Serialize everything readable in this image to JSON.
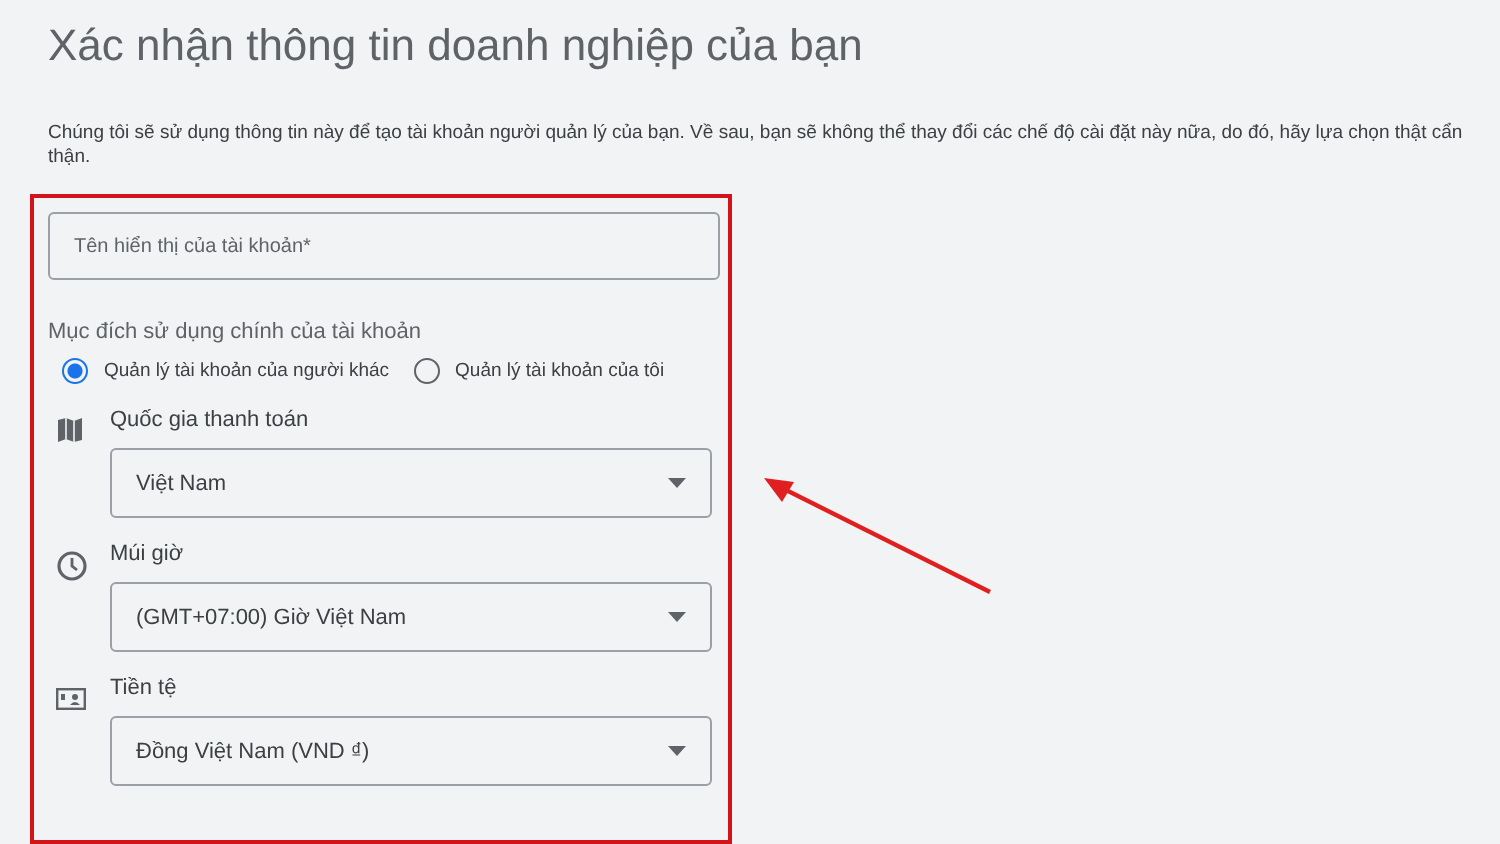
{
  "title": "Xác nhận thông tin doanh nghiệp của bạn",
  "description": "Chúng tôi sẽ sử dụng thông tin này để tạo tài khoản người quản lý của bạn. Về sau, bạn sẽ không thể thay đổi các chế độ cài đặt này nữa, do đó, hãy lựa chọn thật cẩn thận.",
  "name_field": {
    "placeholder": "Tên hiển thị của tài khoản*"
  },
  "purpose": {
    "label": "Mục đích sử dụng chính của tài khoản",
    "options": [
      {
        "label": "Quản lý tài khoản của người khác",
        "selected": true
      },
      {
        "label": "Quản lý tài khoản của tôi",
        "selected": false
      }
    ]
  },
  "sections": [
    {
      "kind": "map",
      "label": "Quốc gia thanh toán",
      "value": "Việt Nam"
    },
    {
      "kind": "clock",
      "label": "Múi giờ",
      "value": "(GMT+07:00) Giờ Việt Nam"
    },
    {
      "kind": "currency",
      "label": "Tiền tệ",
      "value": "Đồng Việt Nam (VND ₫)"
    }
  ]
}
